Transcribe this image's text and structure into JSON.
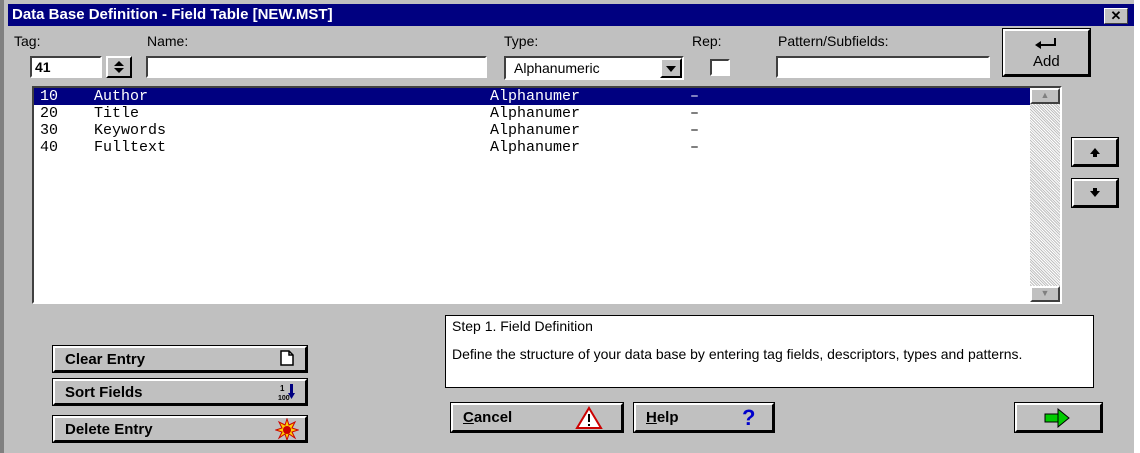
{
  "window": {
    "title": "Data Base Definition - Field Table [NEW.MST]",
    "close_glyph": "✕"
  },
  "labels": {
    "tag": "Tag:",
    "name": "Name:",
    "type": "Type:",
    "rep": "Rep:",
    "pattern": "Pattern/Subfields:"
  },
  "inputs": {
    "tag_value": "41",
    "name_value": "",
    "type_value": "Alphanumeric",
    "rep_checked": false,
    "pattern_value": ""
  },
  "add_button": {
    "label": "Add",
    "icon": "enter-arrow-icon"
  },
  "fields": [
    {
      "tag": "10",
      "name": "Author",
      "type": "Alphanumer",
      "rep": "–",
      "selected": true
    },
    {
      "tag": "20",
      "name": "Title",
      "type": "Alphanumer",
      "rep": "–",
      "selected": false
    },
    {
      "tag": "30",
      "name": "Keywords",
      "type": "Alphanumer",
      "rep": "–",
      "selected": false
    },
    {
      "tag": "40",
      "name": "Fulltext",
      "type": "Alphanumer",
      "rep": "–",
      "selected": false
    }
  ],
  "move_buttons": {
    "up_icon": "arrow-up-icon",
    "down_icon": "arrow-down-icon"
  },
  "info": {
    "heading": "Step 1. Field Definition",
    "body": "Define the structure of your data base by entering tag fields, descriptors, types and patterns."
  },
  "buttons": {
    "clear": "Clear Entry",
    "sort": "Sort Fields",
    "delete": "Delete Entry",
    "cancel_first": "C",
    "cancel_rest": "ancel",
    "help_first": "H",
    "help_rest": "elp",
    "next_icon": "arrow-right-icon"
  },
  "colors": {
    "selection": "#000080",
    "titlebar": "#000080",
    "face": "#c0c0c0",
    "next_arrow": "#00cc00"
  }
}
